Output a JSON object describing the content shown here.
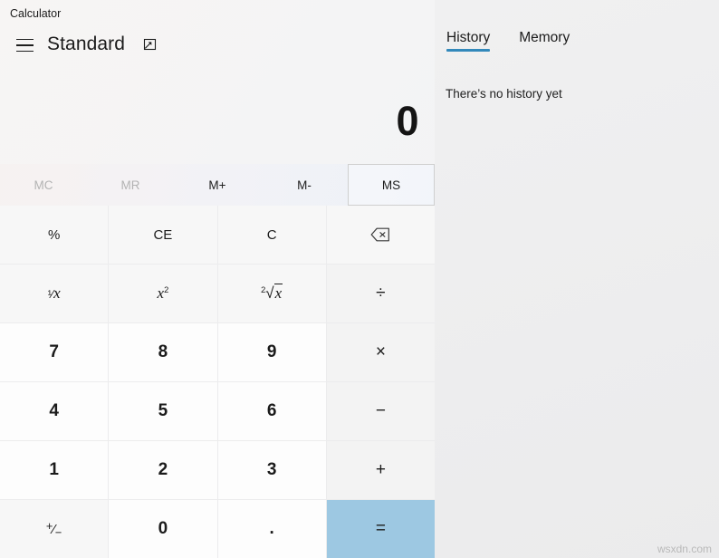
{
  "window": {
    "title": "Calculator",
    "controls": [
      {
        "name": "minimize",
        "label": "─"
      },
      {
        "name": "maximize",
        "label": "□"
      },
      {
        "name": "close",
        "label": "✕"
      }
    ]
  },
  "header": {
    "menu_icon": "hamburger-menu-icon",
    "mode": "Standard",
    "keep_on_top_icon": "keep-on-top-icon"
  },
  "display": {
    "value": "0"
  },
  "memory": {
    "buttons": [
      {
        "label": "MC",
        "name": "memory-clear-button",
        "disabled": true,
        "hovered": false
      },
      {
        "label": "MR",
        "name": "memory-recall-button",
        "disabled": true,
        "hovered": false
      },
      {
        "label": "M+",
        "name": "memory-add-button",
        "disabled": false,
        "hovered": false
      },
      {
        "label": "M-",
        "name": "memory-subtract-button",
        "disabled": false,
        "hovered": false
      },
      {
        "label": "MS",
        "name": "memory-store-button",
        "disabled": false,
        "hovered": true
      }
    ]
  },
  "keypad": {
    "rows": [
      [
        {
          "label": "%",
          "name": "percent-button",
          "kind": "fn"
        },
        {
          "label": "CE",
          "name": "clear-entry-button",
          "kind": "fn"
        },
        {
          "label": "C",
          "name": "clear-button",
          "kind": "fn"
        },
        {
          "label": "",
          "name": "backspace-button",
          "kind": "fn",
          "icon": "backspace-icon"
        }
      ],
      [
        {
          "label": "1/x",
          "name": "reciprocal-button",
          "kind": "fn",
          "glyph": "reciprocal"
        },
        {
          "label": "x2",
          "name": "square-button",
          "kind": "fn",
          "glyph": "square"
        },
        {
          "label": "2√x",
          "name": "square-root-button",
          "kind": "fn",
          "glyph": "sqrt"
        },
        {
          "label": "÷",
          "name": "divide-button",
          "kind": "op"
        }
      ],
      [
        {
          "label": "7",
          "name": "digit-7-button",
          "kind": "num"
        },
        {
          "label": "8",
          "name": "digit-8-button",
          "kind": "num"
        },
        {
          "label": "9",
          "name": "digit-9-button",
          "kind": "num"
        },
        {
          "label": "×",
          "name": "multiply-button",
          "kind": "op"
        }
      ],
      [
        {
          "label": "4",
          "name": "digit-4-button",
          "kind": "num"
        },
        {
          "label": "5",
          "name": "digit-5-button",
          "kind": "num"
        },
        {
          "label": "6",
          "name": "digit-6-button",
          "kind": "num"
        },
        {
          "label": "−",
          "name": "subtract-button",
          "kind": "op"
        }
      ],
      [
        {
          "label": "1",
          "name": "digit-1-button",
          "kind": "num"
        },
        {
          "label": "2",
          "name": "digit-2-button",
          "kind": "num"
        },
        {
          "label": "3",
          "name": "digit-3-button",
          "kind": "num"
        },
        {
          "label": "+",
          "name": "add-button",
          "kind": "op"
        }
      ],
      [
        {
          "label": "+/−",
          "name": "negate-button",
          "kind": "fn",
          "glyph": "negate"
        },
        {
          "label": "0",
          "name": "digit-0-button",
          "kind": "num"
        },
        {
          "label": ".",
          "name": "decimal-point-button",
          "kind": "num"
        },
        {
          "label": "=",
          "name": "equals-button",
          "kind": "equals"
        }
      ]
    ]
  },
  "side_panel": {
    "tabs": [
      {
        "label": "History",
        "name": "tab-history",
        "active": true
      },
      {
        "label": "Memory",
        "name": "tab-memory",
        "active": false
      }
    ],
    "empty_message": "There’s no history yet"
  },
  "watermark": "wsxdn.com",
  "colors": {
    "accent_blue": "#3389bb",
    "equals_blue": "#9dc8e2",
    "close_red": "#e81123"
  }
}
